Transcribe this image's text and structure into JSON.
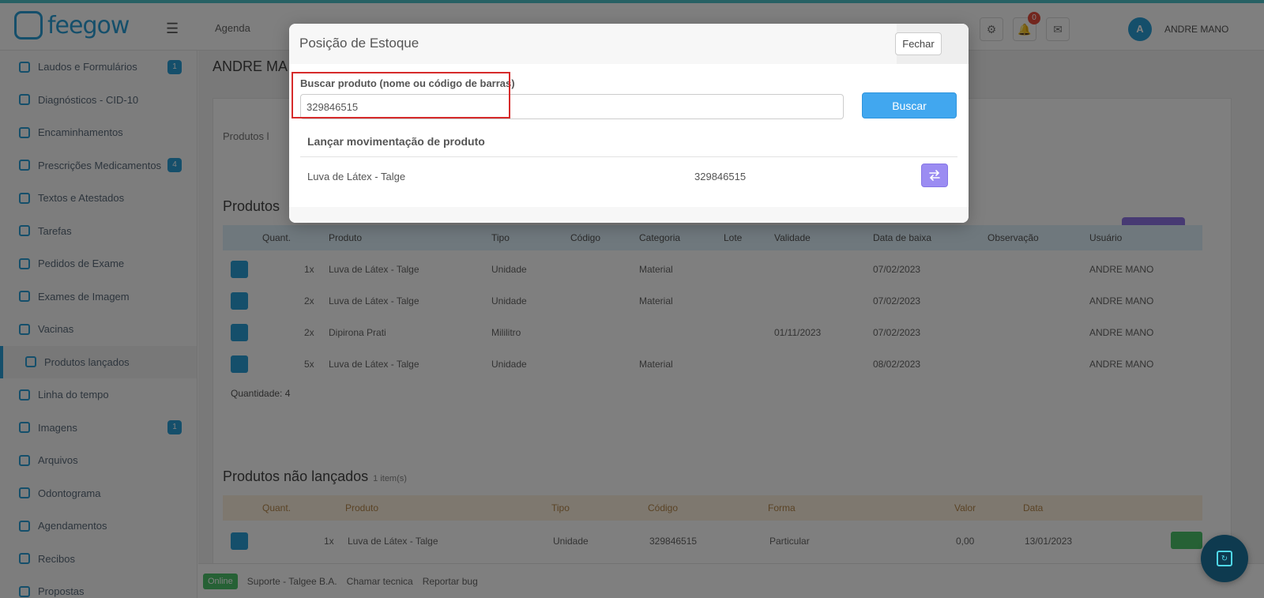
{
  "app": {
    "logo_text": "feegow",
    "top_menu_label": "Agenda",
    "user_name": "ANDRE MANO",
    "user_initial": "A",
    "notification_count": "0"
  },
  "sidebar": {
    "items": [
      {
        "label": "Laudos e Formulários",
        "badge": "1"
      },
      {
        "label": "Diagnósticos - CID-10",
        "badge": ""
      },
      {
        "label": "Encaminhamentos",
        "badge": ""
      },
      {
        "label": "Prescrições Medicamentos",
        "badge": "4"
      },
      {
        "label": "Textos e Atestados",
        "badge": ""
      },
      {
        "label": "Tarefas",
        "badge": ""
      },
      {
        "label": "Pedidos de Exame",
        "badge": ""
      },
      {
        "label": "Exames de Imagem",
        "badge": ""
      },
      {
        "label": "Vacinas",
        "badge": ""
      },
      {
        "label": "Produtos lançados",
        "badge": ""
      },
      {
        "label": "Linha do tempo",
        "badge": ""
      },
      {
        "label": "Imagens",
        "badge": "1"
      },
      {
        "label": "Arquivos",
        "badge": ""
      },
      {
        "label": "Odontograma",
        "badge": ""
      },
      {
        "label": "Agendamentos",
        "badge": ""
      },
      {
        "label": "Recibos",
        "badge": ""
      },
      {
        "label": "Propostas",
        "badge": ""
      }
    ]
  },
  "main": {
    "patient_name": "ANDRE MA",
    "tab_label": "Produtos l",
    "launched": {
      "title": "Produtos",
      "columns": [
        "Quant.",
        "Produto",
        "Tipo",
        "Código",
        "Categoria",
        "Lote",
        "Validade",
        "Data de baixa",
        "Observação",
        "Usuário"
      ],
      "rows": [
        {
          "qty": "1x",
          "product": "Luva de Látex - Talge",
          "type": "Unidade",
          "category": "Material",
          "validity": "",
          "date": "07/02/2023",
          "user": "ANDRE MANO"
        },
        {
          "qty": "2x",
          "product": "Luva de Látex - Talge",
          "type": "Unidade",
          "category": "Material",
          "validity": "",
          "date": "07/02/2023",
          "user": "ANDRE MANO"
        },
        {
          "qty": "2x",
          "product": "Dipirona Prati",
          "type": "Mililitro",
          "category": "",
          "validity": "01/11/2023",
          "date": "07/02/2023",
          "user": "ANDRE MANO"
        },
        {
          "qty": "5x",
          "product": "Luva de Látex - Talge",
          "type": "Unidade",
          "category": "Material",
          "validity": "",
          "date": "08/02/2023",
          "user": "ANDRE MANO"
        }
      ],
      "quantity_text": "Quantidade: 4"
    },
    "not_launched": {
      "title": "Produtos não lançados",
      "subtitle": "1 item(s)",
      "columns": [
        "Quant.",
        "Produto",
        "Tipo",
        "Código",
        "Forma",
        "Valor",
        "Data"
      ],
      "row": {
        "qty": "1x",
        "product": "Luva de Látex - Talge",
        "type": "Unidade",
        "code": "329846515",
        "form": "Particular",
        "value": "0,00",
        "date": "13/01/2023"
      }
    }
  },
  "footer": {
    "status": "Online",
    "items": [
      "Suporte - Talgee B.A.",
      "Chamar tecnica",
      "Reportar bug"
    ]
  },
  "modal": {
    "title": "Posição de Estoque",
    "close_label": "Fechar",
    "search_label": "Buscar produto (nome ou código de barras)",
    "search_value": "329846515",
    "search_button": "Buscar",
    "results_title": "Lançar movimentação de produto",
    "result": {
      "name": "Luva de Látex - Talge",
      "code": "329846515"
    }
  },
  "colors": {
    "accent": "#41a7ef",
    "move_button": "#9b8cf2",
    "highlight": "#d62b2b"
  },
  "icons": {
    "move": "swap-arrows-icon",
    "chat": "chat-widget-icon"
  }
}
